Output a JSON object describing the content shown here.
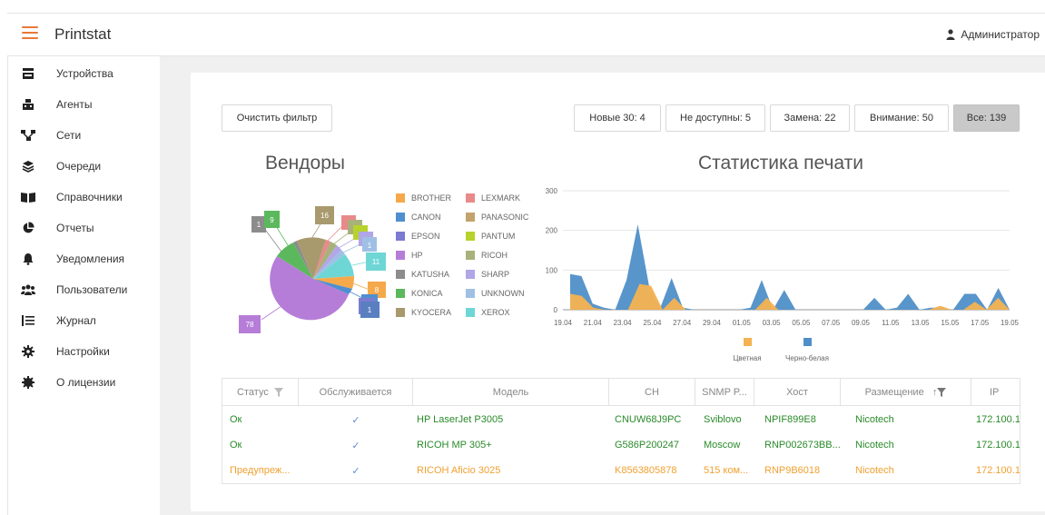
{
  "app": {
    "title": "Printstat",
    "user": "Администратор"
  },
  "sidebar": {
    "items": [
      {
        "label": "Устройства",
        "icon": "printer-icon"
      },
      {
        "label": "Агенты",
        "icon": "agent-icon"
      },
      {
        "label": "Сети",
        "icon": "network-icon"
      },
      {
        "label": "Очереди",
        "icon": "layers-icon"
      },
      {
        "label": "Справочники",
        "icon": "book-icon"
      },
      {
        "label": "Отчеты",
        "icon": "pie-chart-icon"
      },
      {
        "label": "Уведомления",
        "icon": "bell-icon"
      },
      {
        "label": "Пользователи",
        "icon": "users-icon"
      },
      {
        "label": "Журнал",
        "icon": "list-icon"
      },
      {
        "label": "Настройки",
        "icon": "gear-icon"
      },
      {
        "label": "О лицензии",
        "icon": "badge-icon"
      }
    ]
  },
  "toolbar": {
    "clear_filter": "Очистить фильтр",
    "filters": [
      "Новые 30: 4",
      "Не доступны: 5",
      "Замена: 22",
      "Внимание: 50",
      "Все: 139"
    ],
    "active_filter": 4
  },
  "vendors": {
    "title": "Вендоры",
    "legend": [
      {
        "name": "BROTHER",
        "color": "#f5a94a"
      },
      {
        "name": "LEXMARK",
        "color": "#e88a8a"
      },
      {
        "name": "CANON",
        "color": "#4f8fd0"
      },
      {
        "name": "PANASONIC",
        "color": "#c3a36c"
      },
      {
        "name": "EPSON",
        "color": "#7b7bd0"
      },
      {
        "name": "PANTUM",
        "color": "#b8d22c"
      },
      {
        "name": "HP",
        "color": "#b57dd8"
      },
      {
        "name": "RICOH",
        "color": "#a8b17a"
      },
      {
        "name": "KATUSHA",
        "color": "#8c8c8c"
      },
      {
        "name": "SHARP",
        "color": "#b0a6e8"
      },
      {
        "name": "KONICA",
        "color": "#5cb85c"
      },
      {
        "name": "UNKNOWN",
        "color": "#9fc0e4"
      },
      {
        "name": "KYOCERA",
        "color": "#a99a6e"
      },
      {
        "name": "XEROX",
        "color": "#6fd6d6"
      }
    ],
    "labels": [
      "1",
      "9",
      "16",
      "1",
      "11",
      "8",
      "1",
      "78"
    ]
  },
  "chart_data": {
    "type": "area",
    "title": "Статистика печати",
    "x_ticks": [
      "19.04",
      "21.04",
      "23.04",
      "25.04",
      "27.04",
      "29.04",
      "01.05",
      "03.05",
      "05.05",
      "07.05",
      "09.05",
      "11.05",
      "13.05",
      "15.05",
      "17.05",
      "19.05"
    ],
    "y_ticks": [
      0,
      100,
      200,
      300
    ],
    "ylim": [
      0,
      300
    ],
    "series": [
      {
        "name": "Цветная",
        "color": "#f5b250",
        "values": [
          40,
          35,
          5,
          0,
          0,
          0,
          65,
          60,
          0,
          30,
          0,
          0,
          0,
          0,
          0,
          0,
          0,
          30,
          0,
          0,
          0,
          0,
          0,
          0,
          0,
          0,
          0,
          0,
          0,
          0,
          0,
          0,
          10,
          0,
          0,
          20,
          0,
          30,
          0
        ]
      },
      {
        "name": "Черно-белая",
        "color": "#4f8fc8",
        "values": [
          90,
          85,
          15,
          5,
          0,
          75,
          215,
          60,
          5,
          80,
          5,
          0,
          0,
          0,
          0,
          0,
          5,
          75,
          0,
          50,
          0,
          0,
          0,
          0,
          0,
          0,
          0,
          30,
          0,
          5,
          40,
          0,
          5,
          5,
          0,
          40,
          40,
          0,
          55,
          0
        ]
      }
    ],
    "legend": [
      "Цветная",
      "Черно-белая"
    ]
  },
  "grid": {
    "columns": [
      "Статус",
      "Обслуживается",
      "Модель",
      "СН",
      "SNMP P...",
      "Хост",
      "Размещение",
      "IP"
    ],
    "rows": [
      {
        "status": "Ок",
        "serviced": "✓",
        "model": "HP LaserJet P3005",
        "sn": "CNUW68J9PC",
        "snmp": "Sviblovo",
        "host": "NPIF899E8",
        "place": "Nicotech",
        "ip": "172.100.1",
        "level": "ok"
      },
      {
        "status": "Ок",
        "serviced": "✓",
        "model": "RICOH MP 305+",
        "sn": "G586P200247",
        "snmp": "Moscow",
        "host": "RNP002673BB...",
        "place": "Nicotech",
        "ip": "172.100.1",
        "level": "ok"
      },
      {
        "status": "Предупреж...",
        "serviced": "✓",
        "model": "RICOH Aficio 3025",
        "sn": "K8563805878",
        "snmp": "515 ком...",
        "host": "RNP9B6018",
        "place": "Nicotech",
        "ip": "172.100.1",
        "level": "warn"
      }
    ]
  }
}
